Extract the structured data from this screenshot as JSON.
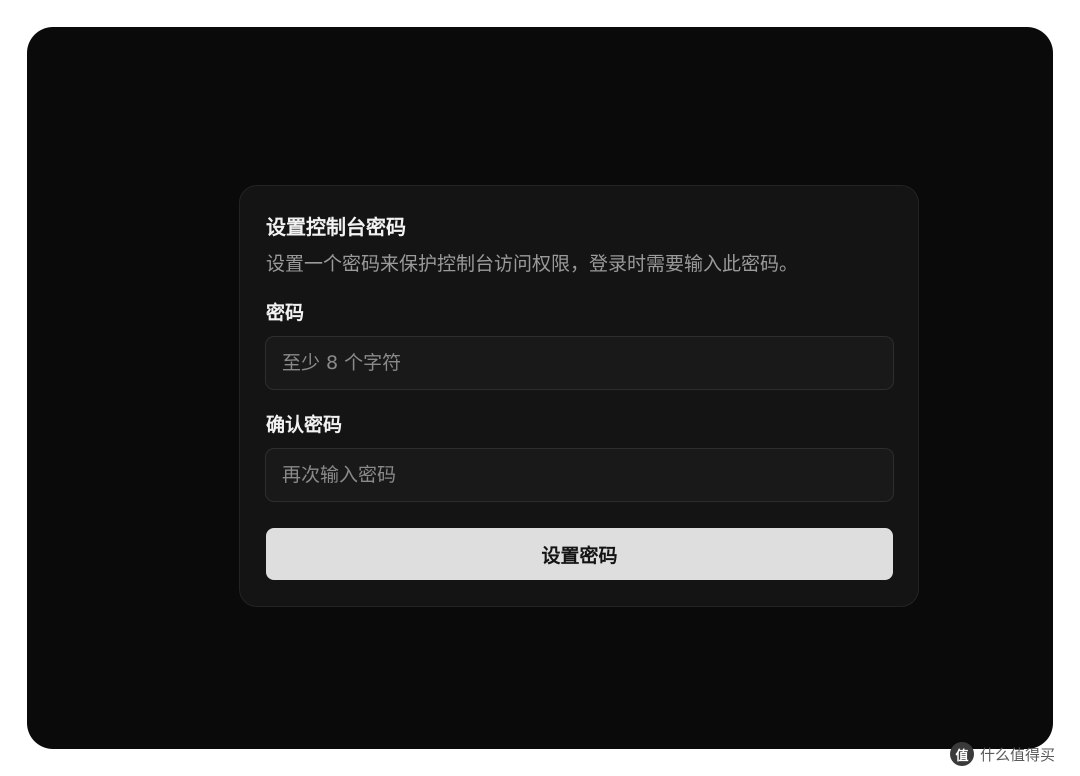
{
  "dialog": {
    "title": "设置控制台密码",
    "description": "设置一个密码来保护控制台访问权限，登录时需要输入此密码。",
    "password": {
      "label": "密码",
      "placeholder": "至少 8 个字符",
      "value": ""
    },
    "confirm": {
      "label": "确认密码",
      "placeholder": "再次输入密码",
      "value": ""
    },
    "submit_label": "设置密码"
  },
  "watermark": {
    "logo_text": "值",
    "text": "什么值得买"
  },
  "colors": {
    "window_background": "#0a0a0a",
    "card_background": "#141414",
    "button_background": "#dedede",
    "text_primary": "#f2f2f2",
    "text_secondary": "#9a9a9a"
  }
}
